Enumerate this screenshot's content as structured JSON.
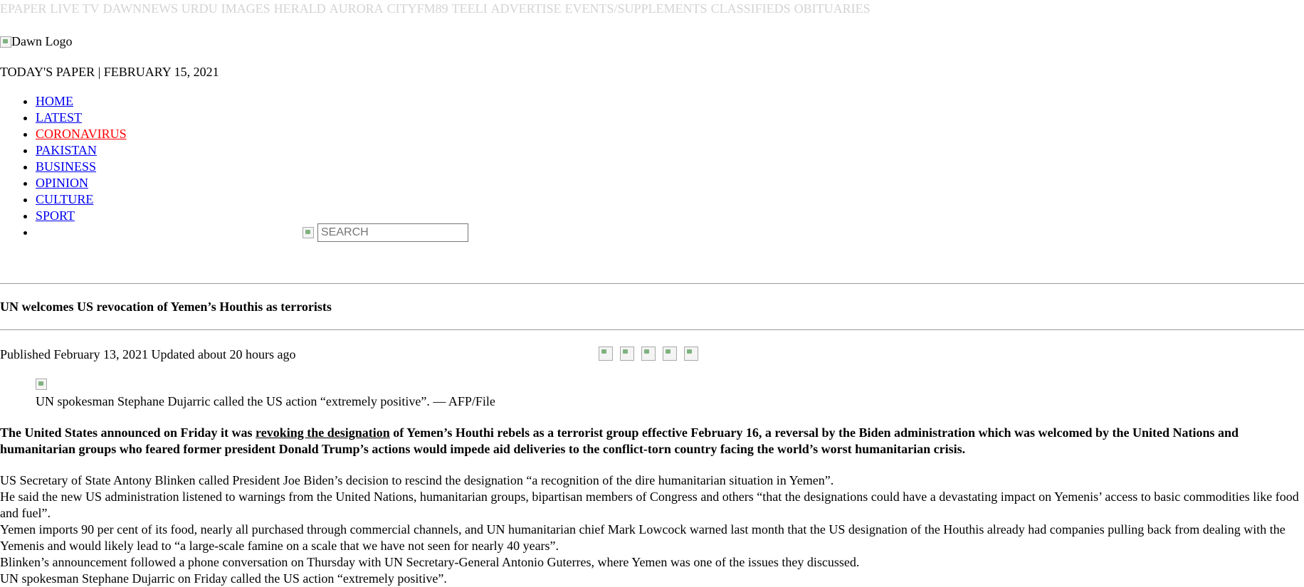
{
  "topbar": {
    "links": [
      "EPAPER",
      "LIVE TV",
      "DAWNNEWS URDU",
      "IMAGES",
      "HERALD",
      "AURORA",
      "CITYFM89",
      "TEELI",
      "ADVERTISE",
      "EVENTS/SUPPLEMENTS",
      "CLASSIFIEDS",
      "OBITUARIES"
    ],
    "color": "#d3d3d3"
  },
  "logo": {
    "alt": "Dawn Logo"
  },
  "todays_paper": "TODAY'S PAPER | FEBRUARY 15, 2021",
  "nav": {
    "items": [
      "HOME",
      "LATEST",
      "CORONAVIRUS",
      "PAKISTAN",
      "BUSINESS",
      "OPINION",
      "CULTURE",
      "SPORT"
    ],
    "highlight_color": "#ff0000"
  },
  "search": {
    "placeholder": "SEARCH"
  },
  "article": {
    "headline": "UN welcomes US revocation of Yemen’s Houthis as terrorists",
    "meta": "Published February 13, 2021 Updated about 20 hours ago",
    "caption": "UN spokesman Stephane Dujarric called the US action “extremely positive”. — AFP/File",
    "lead_before": "The United States announced on Friday it was ",
    "lead_link": "revoking the designation",
    "lead_after": " of Yemen’s Houthi rebels as a terrorist group effective February 16, a reversal by the Biden administration which was welcomed by the United Nations and humanitarian groups who feared former president Donald Trump’s actions would impede aid deliveries to the conflict-torn country facing the world’s worst humanitarian crisis.",
    "paragraphs": [
      "US Secretary of State Antony Blinken called President Joe Biden’s decision to rescind the designation “a recognition of the dire humanitarian situation in Yemen”.",
      "He said the new US administration listened to warnings from the United Nations, humanitarian groups, bipartisan members of Congress and others “that the designations could have a devastating impact on Yemenis’ access to basic commodities like food and fuel”.",
      "Yemen imports 90 per cent of its food, nearly all purchased through commercial channels, and UN humanitarian chief Mark Lowcock warned last month that the US designation of the Houthis already had companies pulling back from dealing with the Yemenis and would likely lead to “a large-scale famine on a scale that we have not seen for nearly 40 years”.",
      "Blinken’s announcement followed a phone conversation on Thursday with UN Secretary-General Antonio Guterres, where Yemen was one of the issues they discussed.",
      "UN spokesman Stephane Dujarric on Friday called the US action “extremely positive”."
    ]
  }
}
